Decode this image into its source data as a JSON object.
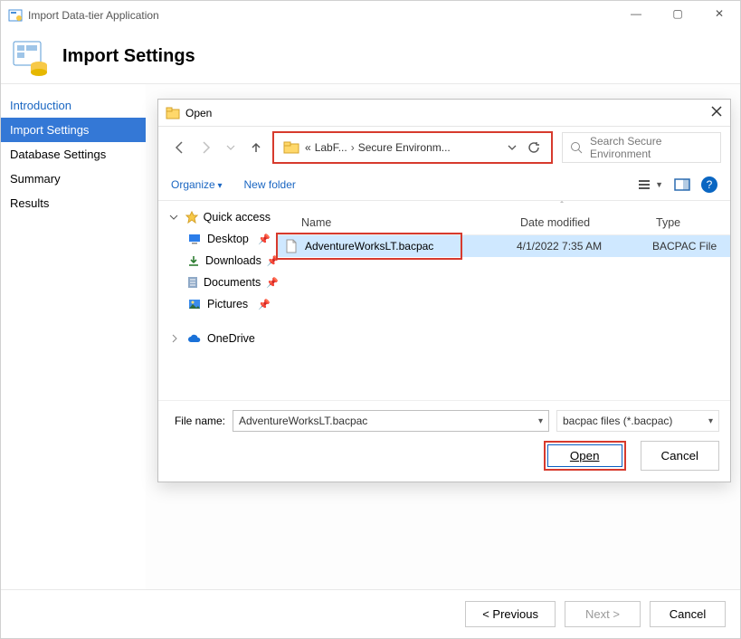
{
  "window": {
    "title": "Import Data-tier Application",
    "controls": {
      "min": "—",
      "max": "▢",
      "close": "✕"
    }
  },
  "header": {
    "title": "Import Settings"
  },
  "sidebar": {
    "items": [
      {
        "label": "Introduction",
        "link": true
      },
      {
        "label": "Import Settings",
        "active": true
      },
      {
        "label": "Database Settings"
      },
      {
        "label": "Summary"
      },
      {
        "label": "Results"
      }
    ]
  },
  "footer": {
    "previous": "< Previous",
    "next": "Next >",
    "cancel": "Cancel"
  },
  "open": {
    "title": "Open",
    "nav": {
      "path_prefix": "«",
      "seg1": "LabF...",
      "seg2": "Secure Environm...",
      "search_placeholder": "Search Secure Environment"
    },
    "toolbar": {
      "organize": "Organize",
      "newfolder": "New folder"
    },
    "tree": {
      "quick": "Quick access",
      "desktop": "Desktop",
      "downloads": "Downloads",
      "documents": "Documents",
      "pictures": "Pictures",
      "onedrive": "OneDrive"
    },
    "columns": {
      "name": "Name",
      "date": "Date modified",
      "type": "Type"
    },
    "file": {
      "name": "AdventureWorksLT.bacpac",
      "date": "4/1/2022 7:35 AM",
      "type": "BACPAC File"
    },
    "filename_label": "File name:",
    "filetype": "bacpac files (*.bacpac)",
    "open_btn": "Open",
    "cancel_btn": "Cancel"
  }
}
